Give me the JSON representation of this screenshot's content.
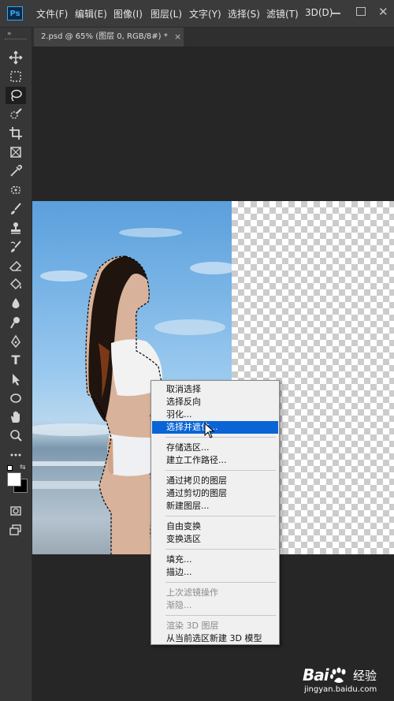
{
  "app": {
    "logo": "Ps",
    "menu": [
      "文件(F)",
      "编辑(E)",
      "图像(I)",
      "图层(L)",
      "文字(Y)",
      "选择(S)",
      "滤镜(T)",
      "3D(D)"
    ]
  },
  "toolbar": {
    "collapse_label": "»",
    "tools": [
      "move-icon",
      "marquee-icon",
      "lasso-icon",
      "quick-select-icon",
      "crop-icon",
      "frame-icon",
      "eyedropper-icon",
      "healing-icon",
      "brush-icon",
      "clone-stamp-icon",
      "history-brush-icon",
      "eraser-icon",
      "paint-bucket-icon",
      "blur-icon",
      "dodge-icon",
      "pen-icon",
      "type-icon",
      "path-select-icon",
      "ellipse-icon",
      "hand-icon",
      "zoom-icon",
      "more-icon",
      "color-swatches-icon",
      "quick-mask-icon",
      "screen-mode-icon"
    ],
    "active_tool": "lasso-icon",
    "type_glyph": "T"
  },
  "document": {
    "tab_title": "2.psd @ 65% (图层 0, RGB/8#) *",
    "close_glyph": "×"
  },
  "context_menu": {
    "groups": [
      [
        {
          "label": "取消选择",
          "highlighted": false,
          "disabled": false
        },
        {
          "label": "选择反向",
          "highlighted": false,
          "disabled": false
        },
        {
          "label": "羽化...",
          "highlighted": false,
          "disabled": false
        },
        {
          "label": "选择并遮住...",
          "highlighted": true,
          "disabled": false
        }
      ],
      [
        {
          "label": "存储选区...",
          "highlighted": false,
          "disabled": false
        },
        {
          "label": "建立工作路径...",
          "highlighted": false,
          "disabled": false
        }
      ],
      [
        {
          "label": "通过拷贝的图层",
          "highlighted": false,
          "disabled": false
        },
        {
          "label": "通过剪切的图层",
          "highlighted": false,
          "disabled": false
        },
        {
          "label": "新建图层...",
          "highlighted": false,
          "disabled": false
        }
      ],
      [
        {
          "label": "自由变换",
          "highlighted": false,
          "disabled": false
        },
        {
          "label": "变换选区",
          "highlighted": false,
          "disabled": false
        }
      ],
      [
        {
          "label": "填充...",
          "highlighted": false,
          "disabled": false
        },
        {
          "label": "描边...",
          "highlighted": false,
          "disabled": false
        }
      ],
      [
        {
          "label": "上次滤镜操作",
          "highlighted": false,
          "disabled": true
        },
        {
          "label": "渐隐...",
          "highlighted": false,
          "disabled": true
        }
      ],
      [
        {
          "label": "渲染 3D 图层",
          "highlighted": false,
          "disabled": true
        },
        {
          "label": "从当前选区新建 3D 模型",
          "highlighted": false,
          "disabled": false
        }
      ]
    ]
  },
  "watermark": {
    "brand": "Bai",
    "brand_suffix": "经验",
    "url": "jingyan.baidu.com"
  },
  "colors": {
    "highlight": "#0a64d6",
    "menubar": "#3b3b3b",
    "toolbar": "#363636",
    "workspace": "#262626"
  }
}
